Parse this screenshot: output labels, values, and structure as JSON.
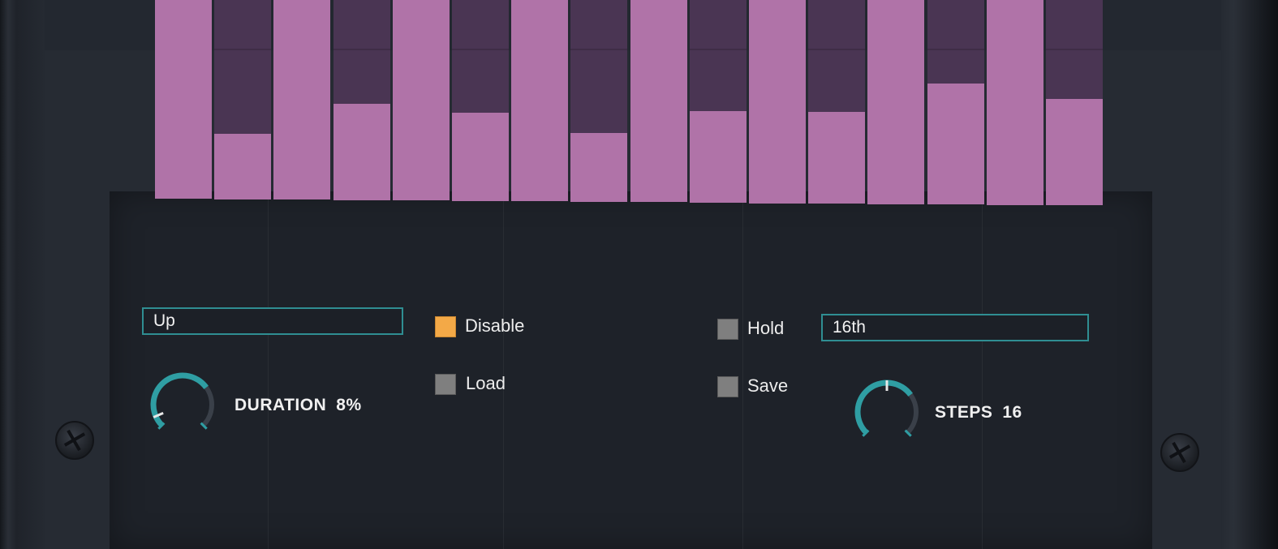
{
  "steps": {
    "count": 16,
    "levels": [
      1.0,
      0.33,
      1.0,
      0.48,
      1.0,
      0.44,
      1.0,
      0.34,
      1.0,
      0.45,
      1.0,
      0.45,
      1.0,
      0.59,
      1.0,
      0.52
    ]
  },
  "mode_select": {
    "value": "Up"
  },
  "rate_select": {
    "value": "16th"
  },
  "options": {
    "disable": {
      "label": "Disable",
      "checked": true
    },
    "load": {
      "label": "Load",
      "checked": false
    },
    "hold": {
      "label": "Hold",
      "checked": false
    },
    "save": {
      "label": "Save",
      "checked": false
    }
  },
  "duration_knob": {
    "label": "DURATION",
    "value": "8%",
    "level": 0.08
  },
  "steps_knob": {
    "label": "STEPS",
    "value": "16",
    "level": 0.5
  },
  "colors": {
    "step_fill": "#b073a8",
    "step_background": "#4a3553",
    "accent_teal": "#2f9ea3",
    "checkbox_on": "#f3a947",
    "checkbox_off": "#7f7f7f"
  }
}
